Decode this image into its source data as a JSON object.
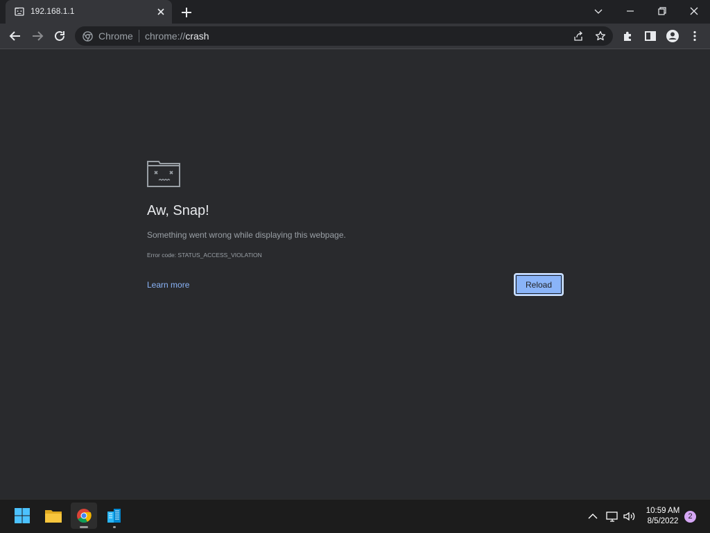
{
  "tab": {
    "title": "192.168.1.1",
    "favicon": "sad-page-icon"
  },
  "toolbar": {
    "origin_label": "Chrome",
    "url_scheme": "chrome://",
    "url_host": "crash"
  },
  "error_page": {
    "heading": "Aw, Snap!",
    "message": "Something went wrong while displaying this webpage.",
    "error_code": "Error code: STATUS_ACCESS_VIOLATION",
    "learn_more": "Learn more",
    "reload_label": "Reload"
  },
  "taskbar": {
    "apps": [
      "windows-start-icon",
      "file-explorer-icon",
      "chrome-icon",
      "buildings-app-icon"
    ],
    "time": "10:59 AM",
    "date": "8/5/2022",
    "notification_count": "2"
  },
  "colors": {
    "page_bg": "#292a2d",
    "toolbar_bg": "#35363a",
    "accent": "#8ab4f8"
  }
}
